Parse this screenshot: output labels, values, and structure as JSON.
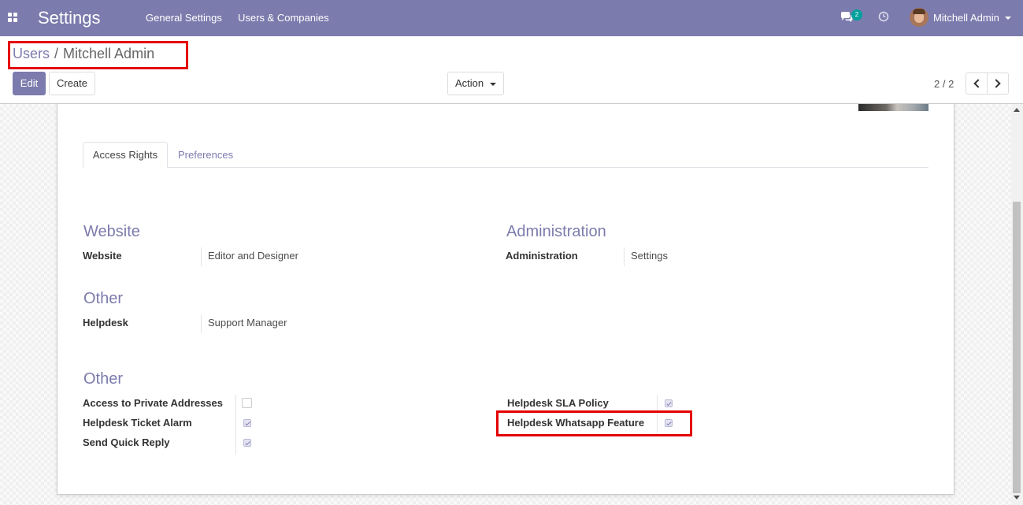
{
  "navbar": {
    "app_title": "Settings",
    "menu": [
      "General Settings",
      "Users & Companies"
    ],
    "chat_badge": "2",
    "user_name": "Mitchell Admin",
    "bg_color": "#7c7bad"
  },
  "breadcrumb": {
    "parent": "Users",
    "separator": "/",
    "current": "Mitchell Admin"
  },
  "toolbar": {
    "edit_label": "Edit",
    "create_label": "Create",
    "action_label": "Action",
    "pager": "2 / 2"
  },
  "tabs": [
    {
      "label": "Access Rights",
      "active": true
    },
    {
      "label": "Preferences",
      "active": false
    }
  ],
  "groups": {
    "website": {
      "title": "Website",
      "field_label": "Website",
      "field_value": "Editor and Designer"
    },
    "administration": {
      "title": "Administration",
      "field_label": "Administration",
      "field_value": "Settings"
    },
    "other1": {
      "title": "Other",
      "field_label": "Helpdesk",
      "field_value": "Support Manager"
    },
    "other2": {
      "title": "Other",
      "left": [
        {
          "label": "Access to Private Addresses",
          "checked": false
        },
        {
          "label": "Helpdesk Ticket Alarm",
          "checked": true
        },
        {
          "label": "Send Quick Reply",
          "checked": true
        }
      ],
      "right": [
        {
          "label": "Helpdesk SLA Policy",
          "checked": true
        },
        {
          "label": "Helpdesk Whatsapp Feature",
          "checked": true
        }
      ]
    }
  },
  "colors": {
    "accent": "#7c7bad",
    "highlight": "#e40001",
    "badge": "#00a09d"
  },
  "icons": [
    "apps-grid-icon",
    "chat-icon",
    "clock-icon",
    "user-avatar",
    "chevron-left-icon",
    "chevron-right-icon",
    "checkbox-icon"
  ]
}
